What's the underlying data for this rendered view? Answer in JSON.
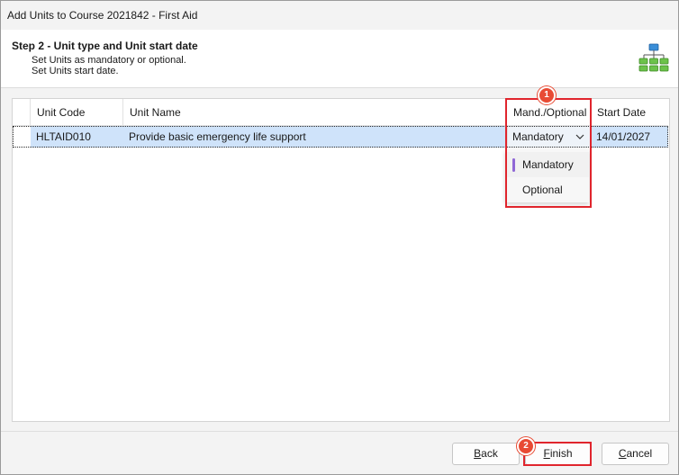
{
  "window": {
    "title": "Add Units to Course 2021842 - First Aid"
  },
  "header": {
    "step_title": "Step 2 - Unit type and Unit start date",
    "desc_line1": "Set Units as mandatory or optional.",
    "desc_line2": "Set Units start date.",
    "icon": "hierarchy-icon"
  },
  "grid": {
    "columns": [
      "Unit Code",
      "Unit Name",
      "Mand./Optional",
      "Start Date"
    ],
    "rows": [
      {
        "unit_code": "HLTAID010",
        "unit_name": "Provide basic emergency life support",
        "mand_optional": "Mandatory",
        "start_date": "14/01/2027",
        "selected": true
      }
    ]
  },
  "dropdown": {
    "options": [
      "Mandatory",
      "Optional"
    ],
    "selected": "Mandatory"
  },
  "annotations": {
    "badge1": "1",
    "badge2": "2"
  },
  "buttons": {
    "back_pre": "",
    "back_key": "B",
    "back_post": "ack",
    "finish_pre": "",
    "finish_key": "F",
    "finish_post": "inish",
    "cancel_pre": "",
    "cancel_key": "C",
    "cancel_post": "ancel"
  },
  "colors": {
    "selection": "#cfe3fa",
    "highlight": "#e0252d",
    "badge": "#e84b34",
    "accent_bar": "#8f67d6"
  }
}
